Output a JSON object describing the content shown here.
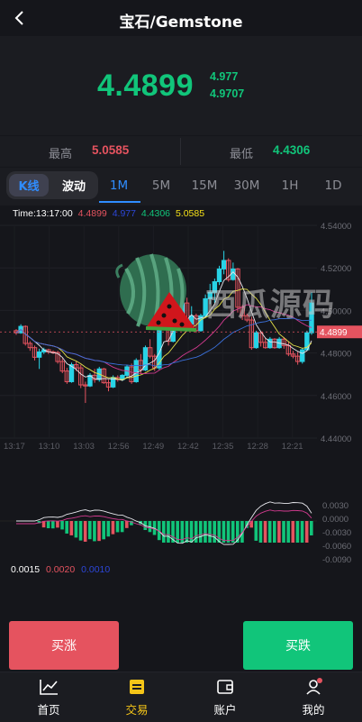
{
  "header": {
    "title": "宝石/Gemstone"
  },
  "price": {
    "current": "4.4899",
    "sub1": "4.977",
    "sub2": "4.9707"
  },
  "stats": {
    "high_label": "最高",
    "high_value": "5.0585",
    "low_label": "最低",
    "low_value": "4.4306"
  },
  "tabs": {
    "kline": "K线",
    "wave": "波动",
    "timeframes": [
      "1M",
      "5M",
      "15M",
      "30M",
      "1H",
      "1D"
    ],
    "active": "1M"
  },
  "legend": {
    "time": "Time:13:17:00",
    "v1": "4.4899",
    "v2": "4.977",
    "v3": "4.4306",
    "v4": "5.0585"
  },
  "macd_legend": {
    "v1": "0.0015",
    "v2": "0.0020",
    "v3": "0.0010"
  },
  "watermark": {
    "text": "西瓜源码"
  },
  "buttons": {
    "rise": "买涨",
    "fall": "买跌"
  },
  "tabbar": {
    "home": "首页",
    "trade": "交易",
    "account": "账户",
    "mine": "我的"
  },
  "colors": {
    "up": "#11c57a",
    "down": "#e5535f",
    "accent": "#2f8dff",
    "active_tab": "#f5c518",
    "candle_up": "#28d3e6",
    "candle_down": "#e5535f"
  },
  "chart_data": [
    {
      "type": "candlestick",
      "title": "",
      "x_ticks": [
        "13:17",
        "13:10",
        "13:03",
        "12:56",
        "12:49",
        "12:42",
        "12:35",
        "12:28",
        "12:21"
      ],
      "y_ticks": [
        "4.54000",
        "4.52000",
        "4.50000",
        "4.48000",
        "4.46000",
        "4.44000"
      ],
      "ylim": [
        4.44,
        4.54
      ],
      "current_price_label": "4.4899",
      "candles": [
        [
          4.4905,
          4.4912,
          4.4885,
          4.4895
        ],
        [
          4.4895,
          4.4935,
          4.489,
          4.4925
        ],
        [
          4.4925,
          4.493,
          4.4835,
          4.4845
        ],
        [
          4.4845,
          4.4855,
          4.481,
          4.4825
        ],
        [
          4.4825,
          4.4835,
          4.4765,
          4.478
        ],
        [
          4.478,
          4.482,
          4.4725,
          4.4805
        ],
        [
          4.4805,
          4.4825,
          4.4795,
          4.4815
        ],
        [
          4.4815,
          4.482,
          4.4795,
          4.4805
        ],
        [
          4.4805,
          4.4812,
          4.4795,
          4.4802
        ],
        [
          4.4802,
          4.481,
          4.475,
          4.476
        ],
        [
          4.476,
          4.4775,
          4.4705,
          4.4715
        ],
        [
          4.4715,
          4.473,
          4.4655,
          4.4665
        ],
        [
          4.4665,
          4.4755,
          4.466,
          4.4745
        ],
        [
          4.4745,
          4.476,
          4.4715,
          4.473
        ],
        [
          4.473,
          4.4745,
          4.4635,
          4.465
        ],
        [
          4.465,
          4.4665,
          4.4565,
          4.4645
        ],
        [
          4.4645,
          4.4705,
          4.464,
          4.4695
        ],
        [
          4.4695,
          4.4725,
          4.466,
          4.4675
        ],
        [
          4.4675,
          4.4735,
          4.4665,
          4.4725
        ],
        [
          4.4725,
          4.473,
          4.4655,
          4.466
        ],
        [
          4.466,
          4.4675,
          4.462,
          4.464
        ],
        [
          4.464,
          4.4695,
          4.4635,
          4.4685
        ],
        [
          4.4685,
          4.4695,
          4.4665,
          4.4675
        ],
        [
          4.4675,
          4.47,
          4.4668,
          4.4695
        ],
        [
          4.4695,
          4.4745,
          4.4685,
          4.4735
        ],
        [
          4.4735,
          4.475,
          4.4655,
          4.4665
        ],
        [
          4.4665,
          4.4775,
          4.466,
          4.4765
        ],
        [
          4.4765,
          4.4795,
          4.4705,
          4.472
        ],
        [
          4.472,
          4.4835,
          4.4715,
          4.4825
        ],
        [
          4.4825,
          4.4865,
          4.4775,
          4.4785
        ],
        [
          4.4785,
          4.4795,
          4.4715,
          4.473
        ],
        [
          4.473,
          4.4955,
          4.472,
          4.4945
        ],
        [
          4.4945,
          4.5075,
          4.4935,
          4.4975
        ],
        [
          4.4975,
          4.5015,
          4.4835,
          4.4855
        ],
        [
          4.4855,
          4.5025,
          4.485,
          4.5015
        ],
        [
          4.5015,
          4.5035,
          4.4925,
          4.494
        ],
        [
          4.494,
          4.5055,
          4.4935,
          4.5035
        ],
        [
          4.5035,
          4.506,
          4.4915,
          4.4935
        ],
        [
          4.4935,
          4.502,
          4.493,
          4.4975
        ],
        [
          4.4975,
          4.4985,
          4.4895,
          4.4905
        ],
        [
          4.4905,
          4.4985,
          4.49,
          4.4975
        ],
        [
          4.4975,
          4.5075,
          4.4965,
          4.5055
        ],
        [
          4.5055,
          4.5125,
          4.503,
          4.5085
        ],
        [
          4.5085,
          4.515,
          4.5035,
          4.5135
        ],
        [
          4.5135,
          4.521,
          4.512,
          4.5195
        ],
        [
          4.5195,
          4.528,
          4.517,
          4.5235
        ],
        [
          4.5235,
          4.5245,
          4.5135,
          4.5145
        ],
        [
          4.5145,
          4.5225,
          4.514,
          4.5195
        ],
        [
          4.5195,
          4.52,
          4.499,
          4.5015
        ],
        [
          4.5015,
          4.5025,
          4.4955,
          4.4975
        ],
        [
          4.4975,
          4.4985,
          4.4945,
          4.4955
        ],
        [
          4.4955,
          4.497,
          4.4815,
          4.4825
        ],
        [
          4.4825,
          4.4905,
          4.482,
          4.4895
        ],
        [
          4.4895,
          4.4905,
          4.483,
          4.485
        ],
        [
          4.485,
          4.487,
          4.482,
          4.4825
        ],
        [
          4.4825,
          4.4875,
          4.482,
          4.4865
        ],
        [
          4.4865,
          4.487,
          4.482,
          4.4825
        ],
        [
          4.4825,
          4.4875,
          4.482,
          4.4865
        ],
        [
          4.4865,
          4.4875,
          4.482,
          4.4835
        ],
        [
          4.4835,
          4.4855,
          4.4785,
          4.4795
        ],
        [
          4.4795,
          4.481,
          4.4775,
          4.4785
        ],
        [
          4.4785,
          4.4805,
          4.4745,
          4.476
        ],
        [
          4.476,
          4.4825,
          4.475,
          4.4815
        ],
        [
          4.4815,
          4.4905,
          4.481,
          4.4895
        ],
        [
          4.4895,
          4.5085,
          4.4885,
          4.5035
        ]
      ]
    }
  ]
}
